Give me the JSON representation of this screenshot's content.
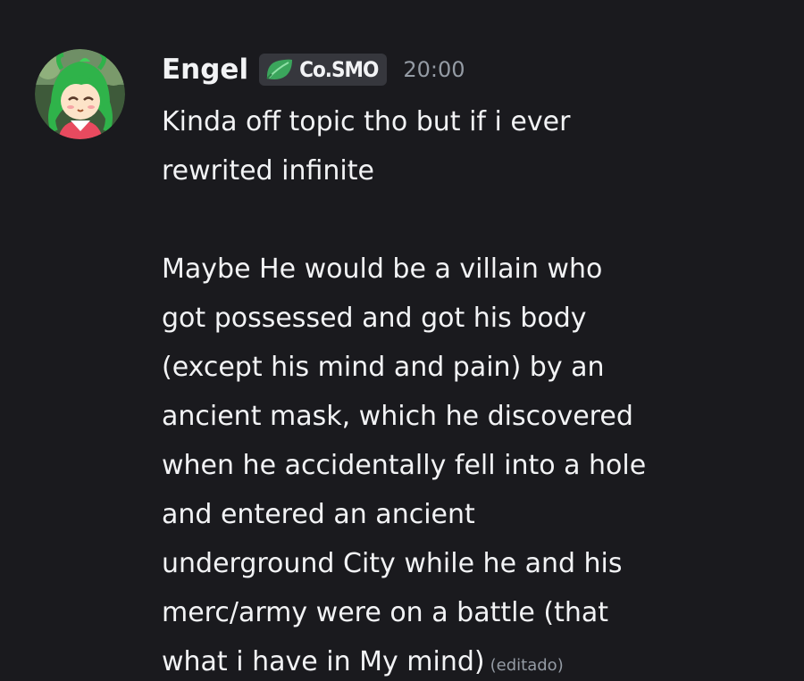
{
  "message": {
    "author": "Engel",
    "server_tag": {
      "icon": "leaf-icon",
      "label": "Co.SMO",
      "color": "#3ba55c"
    },
    "timestamp": "20:00",
    "paragraphs": [
      [
        "Kinda off topic tho but if i ever",
        "rewrited infinite"
      ],
      [
        "Maybe He would be a villain who",
        "got possessed and got his body",
        "(except his mind and pain) by an",
        "ancient mask, which he discovered",
        "when he accidentally fell into a hole",
        "and entered an ancient",
        "underground City while he and his",
        "merc/army were on a battle (that",
        "what i have in My mind)"
      ]
    ],
    "edited_label": "(editado)"
  },
  "colors": {
    "background": "#1a1a1e",
    "text": "#f2f3f5",
    "muted": "#949ba4",
    "tag_bg": "#36373d"
  }
}
